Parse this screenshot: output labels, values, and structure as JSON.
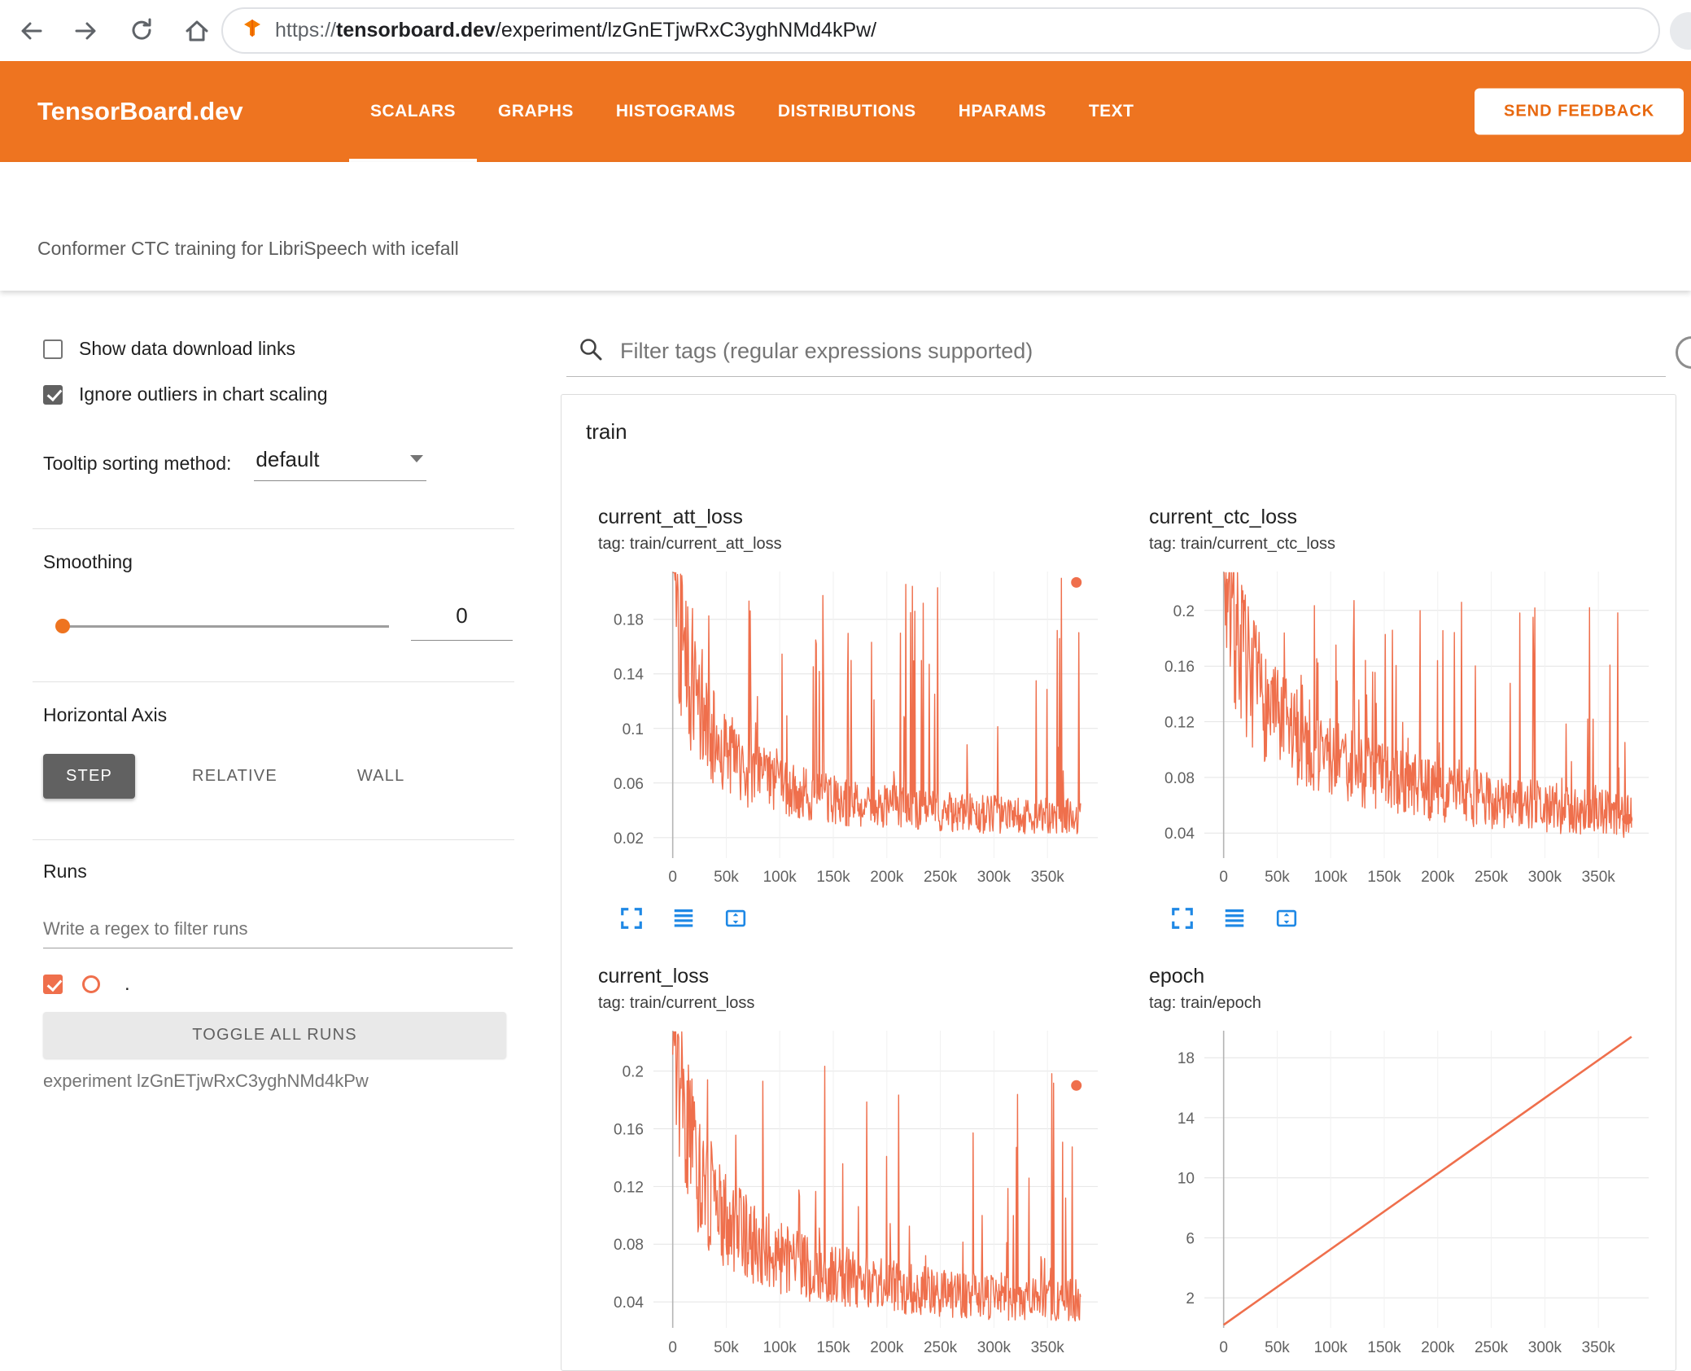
{
  "browser": {
    "url_scheme": "https://",
    "url_host": "tensorboard.dev",
    "url_path": "/experiment/lzGnETjwRxC3yghNMd4kPw/"
  },
  "header": {
    "logo": "TensorBoard.dev",
    "tabs": [
      {
        "label": "SCALARS",
        "active": true
      },
      {
        "label": "GRAPHS",
        "active": false
      },
      {
        "label": "HISTOGRAMS",
        "active": false
      },
      {
        "label": "DISTRIBUTIONS",
        "active": false
      },
      {
        "label": "HPARAMS",
        "active": false
      },
      {
        "label": "TEXT",
        "active": false
      }
    ],
    "feedback_button": "SEND FEEDBACK"
  },
  "experiment": {
    "title": "Conformer CTC training for LibriSpeech with icefall"
  },
  "sidebar": {
    "show_download": {
      "label": "Show data download links",
      "checked": false
    },
    "ignore_outliers": {
      "label": "Ignore outliers in chart scaling",
      "checked": true
    },
    "tooltip_sorting": {
      "label": "Tooltip sorting method:",
      "value": "default"
    },
    "smoothing": {
      "label": "Smoothing",
      "value": "0"
    },
    "horizontal_axis": {
      "label": "Horizontal Axis",
      "options": [
        "STEP",
        "RELATIVE",
        "WALL"
      ],
      "selected": "STEP"
    },
    "runs": {
      "label": "Runs",
      "filter_placeholder": "Write a regex to filter runs",
      "checked": true,
      "run_label": ".",
      "toggle_button": "TOGGLE ALL RUNS",
      "experiment_label": "experiment lzGnETjwRxC3yghNMd4kPw"
    }
  },
  "main": {
    "filter_placeholder": "Filter tags (regular expressions supported)",
    "group_title": "train"
  },
  "colors": {
    "header_orange": "#ee7420",
    "run_color": "#ef6f4c",
    "toolbar_icon_blue": "#1e88e5",
    "feedback_text": "#e8680f"
  },
  "chart_data": [
    {
      "type": "line",
      "kind": "noisy",
      "title": "current_att_loss",
      "subtitle": "tag: train/current_att_loss",
      "color": "#ef6f4c",
      "x_domain": [
        -18000,
        397000
      ],
      "data_x_range": [
        0,
        381000
      ],
      "y_domain": [
        0.005,
        0.215
      ],
      "x_tick_values": [
        0,
        50000,
        100000,
        150000,
        200000,
        250000,
        300000,
        350000
      ],
      "x_tick_labels": [
        "0",
        "50k",
        "100k",
        "150k",
        "200k",
        "250k",
        "300k",
        "350k"
      ],
      "y_tick_values": [
        0.02,
        0.06,
        0.1,
        0.14,
        0.18
      ],
      "y_tick_labels": [
        "0.02",
        "0.06",
        "0.1",
        "0.14",
        "0.18"
      ],
      "baseline": [
        [
          0,
          0.23
        ],
        [
          8000,
          0.17
        ],
        [
          20000,
          0.12
        ],
        [
          40000,
          0.09
        ],
        [
          70000,
          0.068
        ],
        [
          120000,
          0.052
        ],
        [
          180000,
          0.044
        ],
        [
          250000,
          0.039
        ],
        [
          320000,
          0.036
        ],
        [
          381000,
          0.035
        ]
      ],
      "noise": {
        "seed": 42,
        "points": 680,
        "jitter": 0.38,
        "spike_prob": 0.1,
        "spike_max": 0.212
      },
      "end_dot": [
        377000,
        0.207
      ]
    },
    {
      "type": "line",
      "kind": "noisy",
      "title": "current_ctc_loss",
      "subtitle": "tag: train/current_ctc_loss",
      "color": "#ef6f4c",
      "x_domain": [
        -18000,
        397000
      ],
      "data_x_range": [
        0,
        381000
      ],
      "y_domain": [
        0.022,
        0.228
      ],
      "x_tick_values": [
        0,
        50000,
        100000,
        150000,
        200000,
        250000,
        300000,
        350000
      ],
      "x_tick_labels": [
        "0",
        "50k",
        "100k",
        "150k",
        "200k",
        "250k",
        "300k",
        "350k"
      ],
      "y_tick_values": [
        0.04,
        0.08,
        0.12,
        0.16,
        0.2
      ],
      "y_tick_labels": [
        "0.04",
        "0.08",
        "0.12",
        "0.16",
        "0.2"
      ],
      "baseline": [
        [
          0,
          0.235
        ],
        [
          10000,
          0.19
        ],
        [
          25000,
          0.15
        ],
        [
          50000,
          0.12
        ],
        [
          90000,
          0.098
        ],
        [
          140000,
          0.082
        ],
        [
          200000,
          0.07
        ],
        [
          260000,
          0.062
        ],
        [
          320000,
          0.057
        ],
        [
          381000,
          0.052
        ]
      ],
      "noise": {
        "seed": 7,
        "points": 680,
        "jitter": 0.32,
        "spike_prob": 0.09,
        "spike_max": 0.21
      },
      "end_dot": [
        377000,
        0.05
      ]
    },
    {
      "type": "line",
      "kind": "noisy",
      "title": "current_loss",
      "subtitle": "tag: train/current_loss",
      "color": "#ef6f4c",
      "x_domain": [
        -18000,
        397000
      ],
      "data_x_range": [
        0,
        381000
      ],
      "y_domain": [
        0.022,
        0.228
      ],
      "x_tick_values": [
        0,
        50000,
        100000,
        150000,
        200000,
        250000,
        300000,
        350000
      ],
      "x_tick_labels": [
        "0",
        "50k",
        "100k",
        "150k",
        "200k",
        "250k",
        "300k",
        "350k"
      ],
      "y_tick_values": [
        0.04,
        0.08,
        0.12,
        0.16,
        0.2
      ],
      "y_tick_labels": [
        "0.04",
        "0.08",
        "0.12",
        "0.16",
        "0.2"
      ],
      "baseline": [
        [
          0,
          0.235
        ],
        [
          9000,
          0.18
        ],
        [
          22000,
          0.13
        ],
        [
          45000,
          0.1
        ],
        [
          80000,
          0.078
        ],
        [
          130000,
          0.062
        ],
        [
          190000,
          0.052
        ],
        [
          250000,
          0.046
        ],
        [
          320000,
          0.042
        ],
        [
          381000,
          0.041
        ]
      ],
      "noise": {
        "seed": 13,
        "points": 680,
        "jitter": 0.36,
        "spike_prob": 0.095,
        "spike_max": 0.205
      },
      "end_dot": [
        377000,
        0.19
      ]
    },
    {
      "type": "line",
      "kind": "linear",
      "title": "epoch",
      "subtitle": "tag: train/epoch",
      "color": "#ef6f4c",
      "x_domain": [
        -18000,
        397000
      ],
      "y_domain": [
        0,
        19.8
      ],
      "x_tick_values": [
        0,
        50000,
        100000,
        150000,
        200000,
        250000,
        300000,
        350000
      ],
      "x_tick_labels": [
        "0",
        "50k",
        "100k",
        "150k",
        "200k",
        "250k",
        "300k",
        "350k"
      ],
      "y_tick_values": [
        2,
        6,
        10,
        14,
        18
      ],
      "y_tick_labels": [
        "2",
        "6",
        "10",
        "14",
        "18"
      ],
      "points": [
        [
          0,
          0.2
        ],
        [
          381000,
          19.4
        ]
      ]
    }
  ]
}
